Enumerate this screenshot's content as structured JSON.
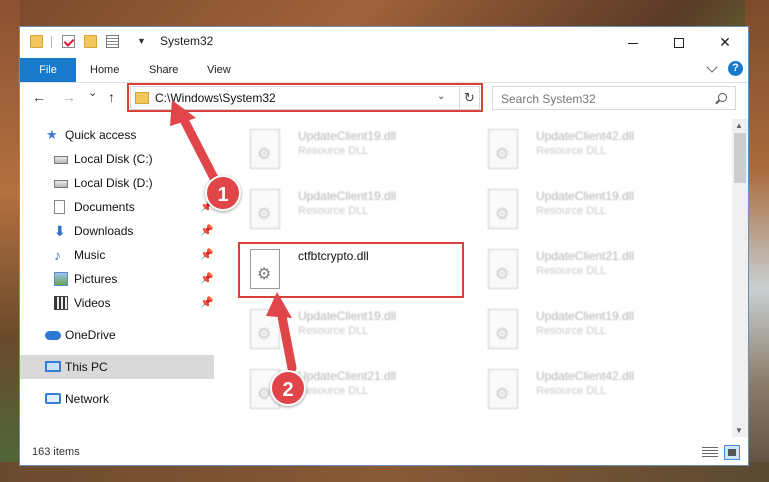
{
  "window": {
    "title": "System32",
    "controls": {
      "minimize": "minimize",
      "maximize": "maximize",
      "close": "✕"
    }
  },
  "ribbon": {
    "tabs": [
      "File",
      "Home",
      "Share",
      "View"
    ],
    "help": "?"
  },
  "address": {
    "path": "C:\\Windows\\System32",
    "refresh": "↻"
  },
  "search": {
    "placeholder": "Search System32"
  },
  "nav": {
    "back": "←",
    "forward": "→",
    "recent": "⌄",
    "up": "↑",
    "items": [
      {
        "label": "Quick access"
      },
      {
        "label": "Local Disk (C:)"
      },
      {
        "label": "Local Disk (D:)"
      },
      {
        "label": "Documents"
      },
      {
        "label": "Downloads"
      },
      {
        "label": "Music"
      },
      {
        "label": "Pictures"
      },
      {
        "label": "Videos"
      },
      {
        "label": "OneDrive"
      },
      {
        "label": "This PC"
      },
      {
        "label": "Network"
      }
    ]
  },
  "files": [
    {
      "name": "UpdateClient19.dll",
      "desc": "Resource DLL"
    },
    {
      "name": "UpdateClient42.dll",
      "desc": "Resource DLL"
    },
    {
      "name": "UpdateClient19.dll",
      "desc": "Resource DLL"
    },
    {
      "name": "UpdateClient19.dll",
      "desc": "Resource DLL"
    },
    {
      "name": "ctfbtcrypto.dll",
      "desc": ""
    },
    {
      "name": "UpdateClient21.dll",
      "desc": "Resource DLL"
    },
    {
      "name": "UpdateClient19.dll",
      "desc": "Resource DLL"
    },
    {
      "name": "UpdateClient19.dll",
      "desc": "Resource DLL"
    },
    {
      "name": "UpdateClient21.dll",
      "desc": "Resource DLL"
    },
    {
      "name": "UpdateClient42.dll",
      "desc": "Resource DLL"
    }
  ],
  "status": {
    "items": "163 items"
  },
  "annotations": {
    "step1": "1",
    "step2": "2",
    "color": "#e0454a"
  },
  "colors": {
    "accent": "#1979ca",
    "highlight": "#d9403a"
  }
}
